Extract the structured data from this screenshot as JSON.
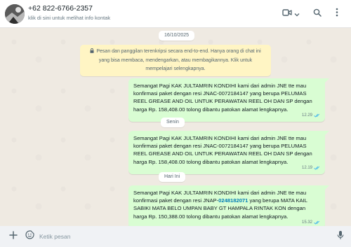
{
  "header": {
    "contact_name": "+62 822-6766-2357",
    "contact_sub": "klik di sini untuk melihat info kontak",
    "icons": [
      "video-call-icon",
      "chevron-down-icon",
      "search-icon",
      "menu-icon"
    ]
  },
  "chat": {
    "date_first": "16/10/2025",
    "encryption_notice": "Pesan dan panggilan terenkripsi secara end-to-end. Hanya orang di chat ini yang bisa membaca, mendengarkan, atau membagikannya. Klik untuk mempelajari selengkapnya.",
    "messages": [
      {
        "text": "Semangat Pagi KAK JULTAMRIN KONDIHI kami dari admin JNE tte mau konfirmasi paket dengan resi JNAC-0072184147 yang berupa PELUMAS REEL GREASE AND OIL UNTUK PERAWATAN REEL OH DAN SP dengan harga Rp. 158,408.00 tolong dibantu patokan alamat lengkapnya.",
        "time": "12.29"
      },
      {
        "separator": "Senin",
        "text": "Semangat Pagi KAK JULTAMRIN KONDIHI kami dari admin JNE tte mau konfirmasi paket dengan resi JNAC-0072184147 yang berupa PELUMAS REEL GREASE AND OIL UNTUK PERAWATAN REEL OH DAN SP dengan harga Rp. 158,408.00 tolong dibantu patokan alamat lengkapnya.",
        "time": "12.19"
      },
      {
        "separator": "Hari Ini",
        "text_before": "Semangat Pagi KAK JULTAMRIN KONDIHI kami dari admin JNE tte mau konfirmasi paket dengan resi JNAP-",
        "text_link": "0248182071",
        "text_after": " yang berupa MATA KAIL SABIKI MATA BELO UMPAN BABY GT HAMPALA RINTAK KON dengan harga Rp. 150,388.00 tolong dibantu patokan alamat lengkapnya.",
        "time": "15.32"
      }
    ]
  },
  "composer": {
    "placeholder": "Ketik pesan",
    "icons": [
      "plus-icon",
      "sticker-icon",
      "microphone-icon"
    ]
  },
  "colors": {
    "outgoing_bubble": "#d9fdd3",
    "read_ticks": "#53bdeb",
    "notice_bg": "#fff5c4"
  }
}
